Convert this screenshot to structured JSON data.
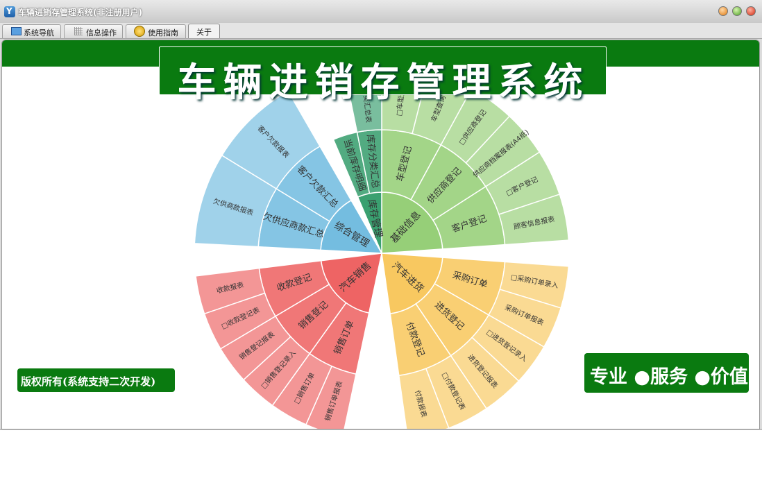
{
  "window": {
    "title": "车辆进销存管理系统(非注册用户)",
    "accent_color": "#0a7a10"
  },
  "tabs": [
    {
      "label": "系统导航",
      "icon": "navigation-icon"
    },
    {
      "label": "信息操作",
      "icon": "grid-icon"
    },
    {
      "label": "使用指南",
      "icon": "guide-icon"
    },
    {
      "label": "关于",
      "icon": ""
    }
  ],
  "banner": {
    "title": "车辆进销存管理系统"
  },
  "copyright": "版权所有(系统支持二次开发)",
  "slogan": "专业 ●服务 ●价值",
  "sunburst": {
    "categories": [
      {
        "label": "基础信息",
        "color": "#96cf78",
        "children": [
          {
            "label": "车型登记",
            "children": [
              "□车型登记",
              "车型查询"
            ]
          },
          {
            "label": "供应商登记",
            "children": [
              "□供应商登记",
              "供应商档案报表(A4纸)"
            ]
          },
          {
            "label": "客户登记",
            "children": [
              "□客户登记",
              "顾客信息报表"
            ]
          }
        ]
      },
      {
        "label": "汽车进货",
        "color": "#f8c860",
        "children": [
          {
            "label": "采购订单",
            "children": [
              "□采购订单录入",
              "采购订单报表"
            ]
          },
          {
            "label": "进货登记",
            "children": [
              "□进货登记录入",
              "进货登记报表"
            ]
          },
          {
            "label": "付款登记",
            "children": [
              "□付款登记表",
              "付款报表"
            ]
          }
        ]
      },
      {
        "label": "汽车销售",
        "color": "#ee6464",
        "children": [
          {
            "label": "销售订单",
            "children": [
              "销售订单报表",
              "□销售订单"
            ]
          },
          {
            "label": "销售登记",
            "children": [
              "□销售登记录入",
              "销售登记报表"
            ]
          },
          {
            "label": "收款登记",
            "children": [
              "□收款登记表",
              "收款报表"
            ]
          }
        ]
      },
      {
        "label": "综合管理",
        "color": "#74bde0",
        "children": [
          {
            "label": "欠供应商款汇总",
            "children": [
              "欠供商款报表"
            ]
          },
          {
            "label": "客户欠款汇总",
            "children": [
              "客户欠款报表"
            ]
          }
        ]
      },
      {
        "label": "库存管理",
        "color": "#3aa070",
        "children": [
          {
            "label": "当前库存明细",
            "children": []
          },
          {
            "label": "库存分类汇总",
            "children": [
              "库存分类汇总表"
            ]
          }
        ]
      }
    ]
  }
}
